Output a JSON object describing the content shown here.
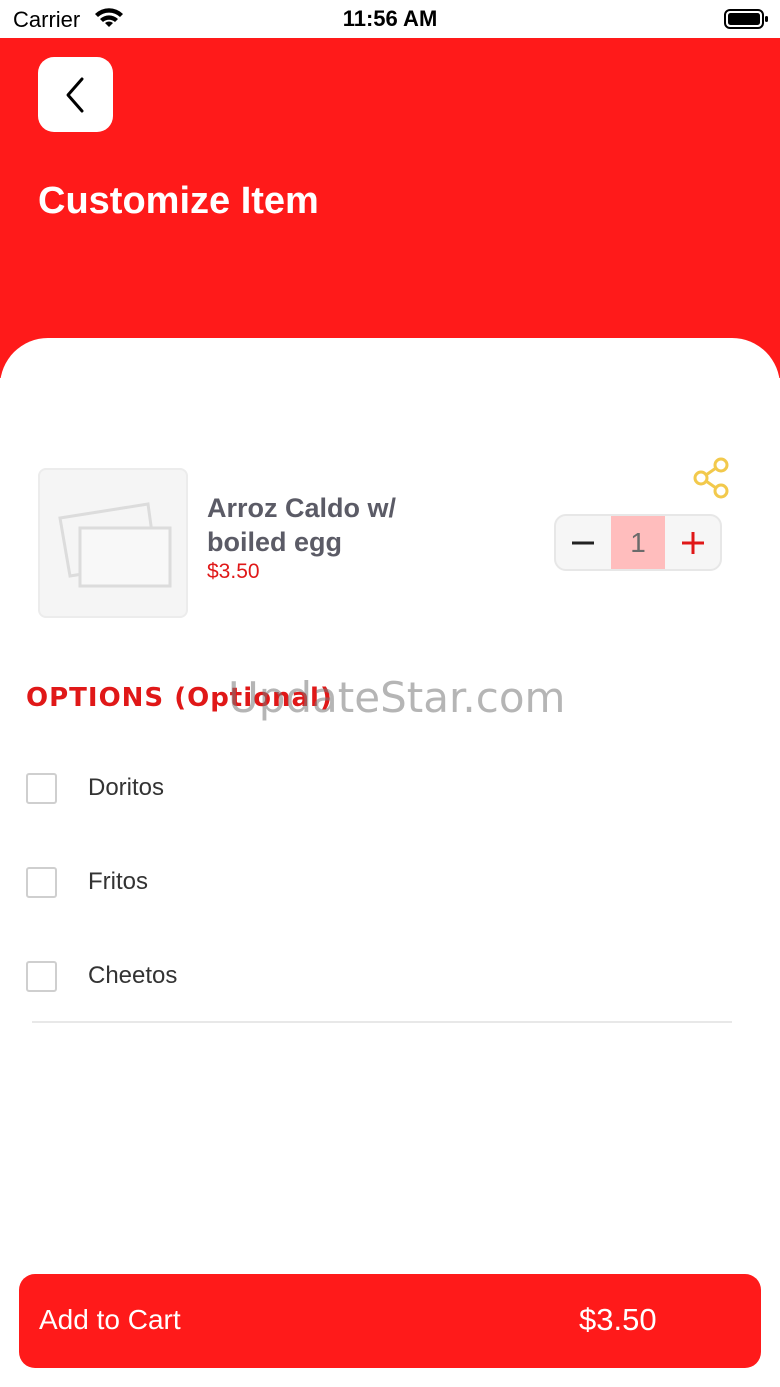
{
  "status_bar": {
    "carrier": "Carrier",
    "time": "11:56 AM"
  },
  "header": {
    "back_icon": "chevron-left-icon",
    "title": "Customize Item",
    "background_color": "#ff1a1a"
  },
  "item": {
    "name": "Arroz Caldo w/ boiled egg",
    "price": "$3.50",
    "image_icon": "image-placeholder-icon",
    "share_icon": "share-icon",
    "quantity": "1",
    "decrement_icon": "minus-icon",
    "increment_icon": "plus-icon"
  },
  "options": {
    "title": "OPTIONS (Optional)",
    "items": [
      {
        "label": "Doritos",
        "checked": false
      },
      {
        "label": "Fritos",
        "checked": false
      },
      {
        "label": "Cheetos",
        "checked": false
      }
    ]
  },
  "watermark": "UpdateStar.com",
  "cart_button": {
    "label": "Add to Cart",
    "price": "$3.50"
  },
  "colors": {
    "accent": "#ff1a1a",
    "price_text": "#e01818",
    "share_icon": "#f2c94c",
    "stepper_value_bg": "#ffbdbd"
  }
}
